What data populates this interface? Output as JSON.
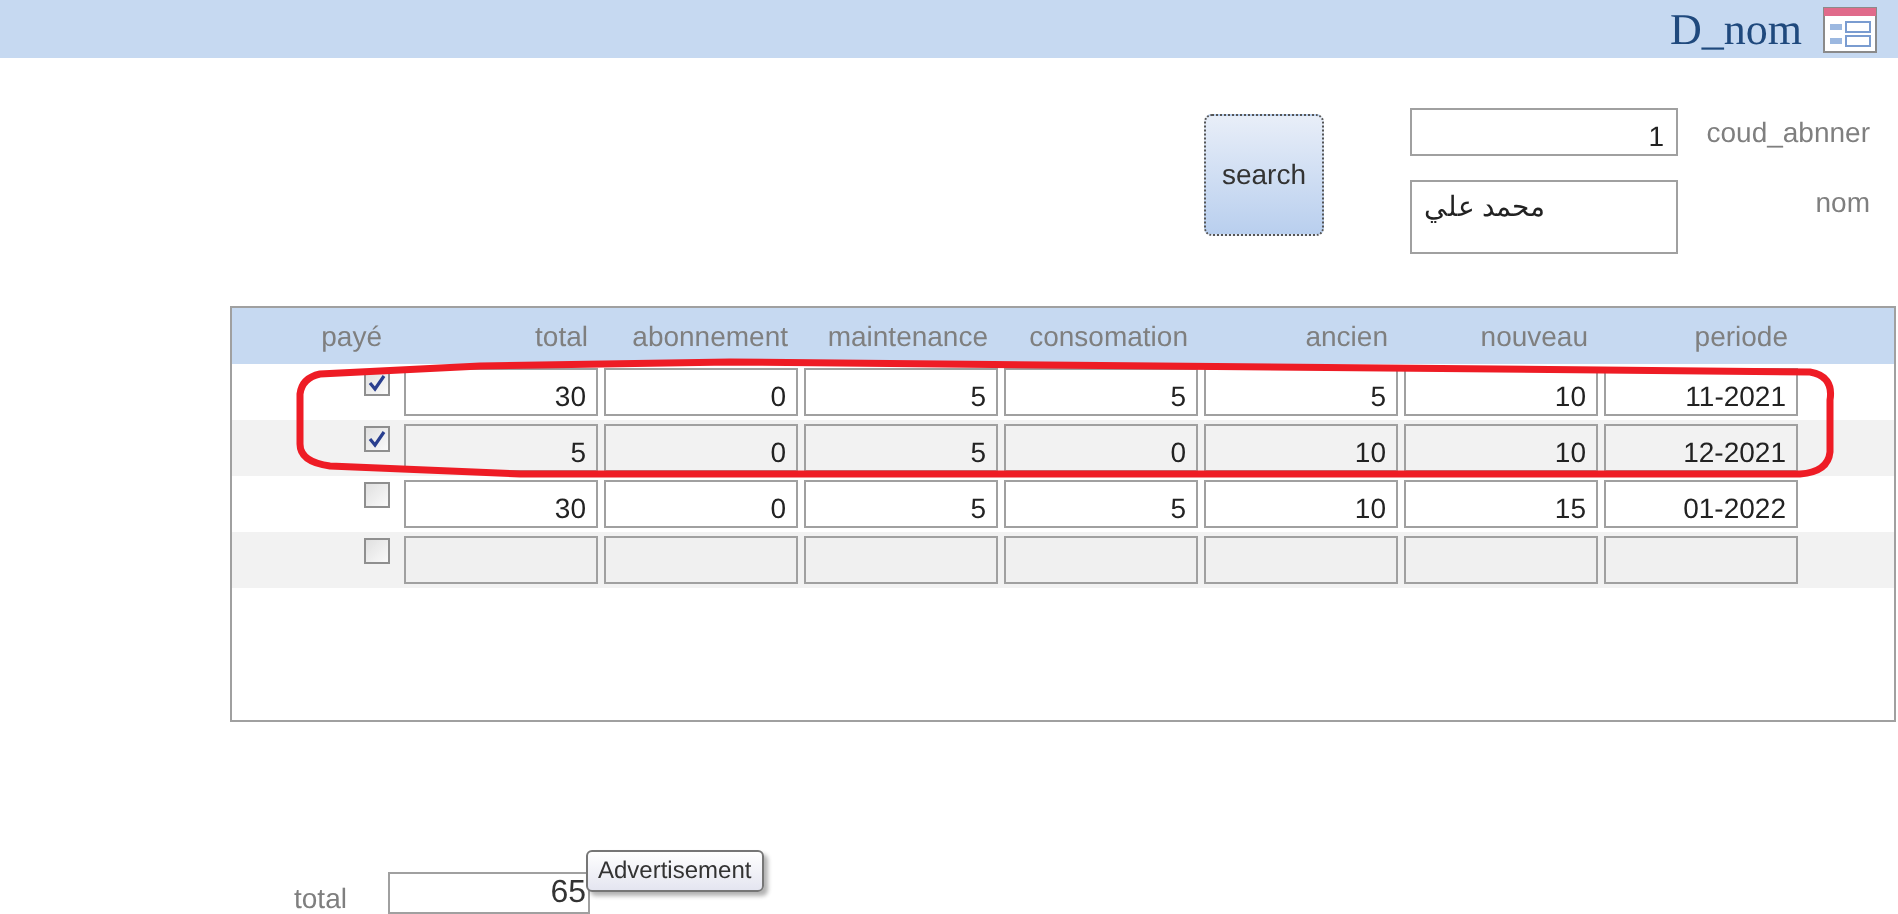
{
  "header": {
    "title": "D_nom"
  },
  "search_button": "search",
  "fields": [
    {
      "label": "coud_abnner",
      "value": "1"
    },
    {
      "label": "nom",
      "value": "محمد علي"
    }
  ],
  "table": {
    "columns": [
      "payé",
      "total",
      "abonnement",
      "maintenance",
      "consomation",
      "ancien",
      "nouveau",
      "periode"
    ],
    "rows": [
      {
        "paid": true,
        "cells": [
          "30",
          "0",
          "5",
          "5",
          "5",
          "10",
          "11-2021"
        ]
      },
      {
        "paid": true,
        "cells": [
          "5",
          "0",
          "5",
          "0",
          "10",
          "10",
          "12-2021"
        ]
      },
      {
        "paid": false,
        "cells": [
          "30",
          "0",
          "5",
          "5",
          "10",
          "15",
          "01-2022"
        ]
      },
      {
        "paid": false
      }
    ]
  },
  "total": {
    "label": "total",
    "value": "65"
  },
  "tooltip": "Advertisement"
}
